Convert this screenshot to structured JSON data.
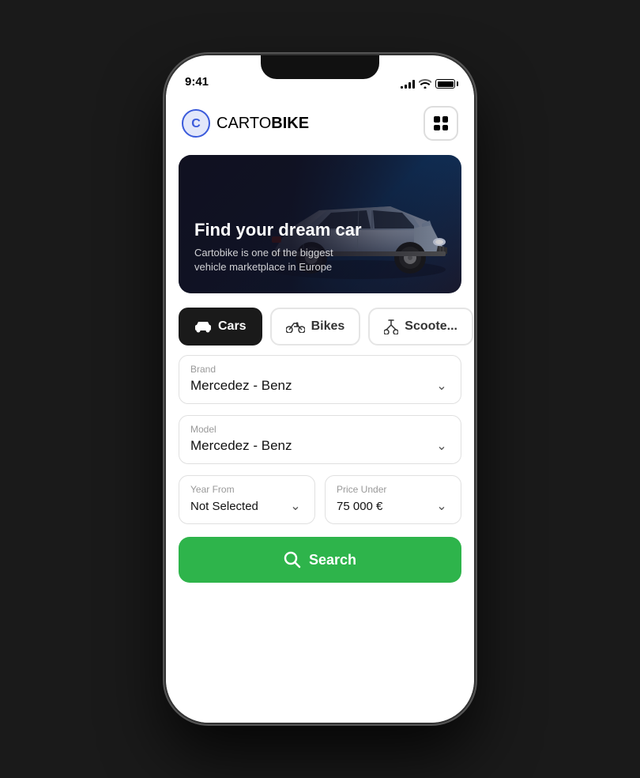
{
  "status_bar": {
    "time": "9:41"
  },
  "header": {
    "logo_text_carto": "CARTO",
    "logo_text_bike": "BIKE",
    "menu_label": "Menu"
  },
  "hero": {
    "title": "Find your dream car",
    "subtitle": "Cartobike is one of the biggest vehicle marketplace in Europe"
  },
  "categories": {
    "tabs": [
      {
        "id": "cars",
        "label": "Cars",
        "active": true
      },
      {
        "id": "bikes",
        "label": "Bikes",
        "active": false
      },
      {
        "id": "scooters",
        "label": "Scoote...",
        "active": false
      }
    ]
  },
  "form": {
    "brand_label": "Brand",
    "brand_value": "Mercedez - Benz",
    "model_label": "Model",
    "model_value": "Mercedez - Benz",
    "year_from_label": "Year From",
    "year_from_value": "Not Selected",
    "price_under_label": "Price Under",
    "price_under_value": "75 000 €"
  },
  "search_button": {
    "label": "Search"
  },
  "colors": {
    "accent_green": "#2eb44b",
    "accent_blue": "#3b5bdb",
    "tab_active_bg": "#1a1a1a"
  }
}
